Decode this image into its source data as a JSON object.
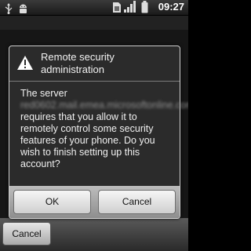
{
  "status_bar": {
    "time": "09:27",
    "icons": [
      "usb-icon",
      "android-debug-icon",
      "sim-icon",
      "signal-icon",
      "battery-icon"
    ]
  },
  "background": {
    "cancel_label": "Cancel"
  },
  "dialog": {
    "title": "Remote security administration",
    "body_prefix": "The server",
    "server_name_redacted": "red0602.mail.emea.microsoftonline.com",
    "body_suffix": "requires that you allow it to remotely control some security features of your phone. Do you wish to finish setting up this account?",
    "ok_label": "OK",
    "cancel_label": "Cancel",
    "icon": "warning-icon"
  },
  "colors": {
    "dialog_bg": "#2b2b2b",
    "button_bar": "#a9a9a9",
    "text": "#f0f0f0"
  }
}
